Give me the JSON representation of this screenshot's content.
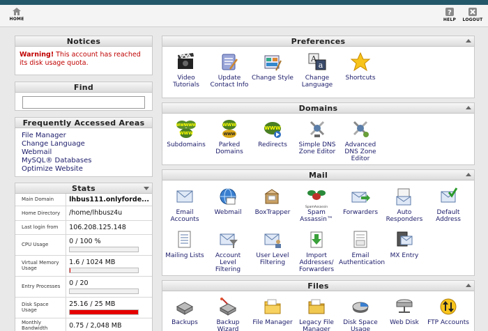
{
  "topbar": {
    "home_label": "HOME",
    "help_label": "HELP",
    "logout_label": "LOGOUT"
  },
  "notices": {
    "title": "Notices",
    "warning_label": "Warning!",
    "warning_text": " This account has reached its disk usage quota."
  },
  "find": {
    "title": "Find",
    "value": ""
  },
  "faa": {
    "title": "Frequently Accessed Areas",
    "links": [
      "File Manager",
      "Change Language",
      "Webmail",
      "MySQL® Databases",
      "Optimize Website"
    ]
  },
  "stats": {
    "title": "Stats",
    "rows": [
      {
        "label": "Main Domain",
        "value": "lhbus111.onlyforde..."
      },
      {
        "label": "Home Directory",
        "value": "/home/lhbusz4u"
      },
      {
        "label": "Last login from",
        "value": "106.208.125.148"
      },
      {
        "label": "CPU Usage",
        "value": "0 / 100 %",
        "progress": 0
      },
      {
        "label": "Virtual Memory Usage",
        "value": "1.6 / 1024 MB",
        "progress": 0.0016
      },
      {
        "label": "Entry Processes",
        "value": "0 / 20",
        "progress": 0
      },
      {
        "label": "Disk Space Usage",
        "value": "25.16 / 25 MB",
        "progress": 1.0
      },
      {
        "label": "Monthly Bandwidth",
        "value": "0.75 / 2,048 MB"
      }
    ]
  },
  "sections": {
    "preferences": {
      "title": "Preferences",
      "items": [
        "Video Tutorials",
        "Update Contact Info",
        "Change Style",
        "Change Language",
        "Shortcuts"
      ]
    },
    "domains": {
      "title": "Domains",
      "items": [
        "Subdomains",
        "Parked Domains",
        "Redirects",
        "Simple DNS Zone Editor",
        "Advanced DNS Zone Editor"
      ]
    },
    "mail": {
      "title": "Mail",
      "items": [
        "Email Accounts",
        "Webmail",
        "BoxTrapper",
        "Spam Assassin™",
        "Forwarders",
        "Auto Responders",
        "Default Address",
        "Mailing Lists",
        "Account Level Filtering",
        "User Level Filtering",
        "Import Addresses/ Forwarders",
        "Email Authentication",
        "MX Entry"
      ],
      "spam_logo_text": "SpamAssassin"
    },
    "files": {
      "title": "Files",
      "items": [
        "Backups",
        "Backup Wizard",
        "File Manager",
        "Legacy File Manager",
        "Disk Space Usage",
        "Web Disk",
        "FTP Accounts"
      ]
    }
  },
  "colors": {
    "top_stripe": "#23586a",
    "warning": "#c00000",
    "disk_bar": "#e60000",
    "link": "#1a1a6a"
  },
  "icons": {
    "preferences": [
      "film-clapper-icon",
      "contact-card-icon",
      "palette-icon",
      "language-icon",
      "star-icon"
    ],
    "domains": [
      "www-globe-icon",
      "parked-www-icon",
      "redirect-www-icon",
      "dns-satellite-icon",
      "advanced-dns-satellite-icon"
    ],
    "mail": [
      "envelope-icon",
      "globe-icon",
      "mailbox-icon",
      "spamassassin-icon",
      "forward-envelope-icon",
      "auto-responder-icon",
      "default-address-icon",
      "mailing-list-icon",
      "filter-icon",
      "user-filter-icon",
      "import-icon",
      "authentication-icon",
      "mx-entry-icon"
    ],
    "files": [
      "backup-drive-icon",
      "backup-wizard-icon",
      "folder-icon",
      "legacy-folder-icon",
      "pie-chart-icon",
      "web-disk-icon",
      "ftp-arrows-icon"
    ]
  }
}
